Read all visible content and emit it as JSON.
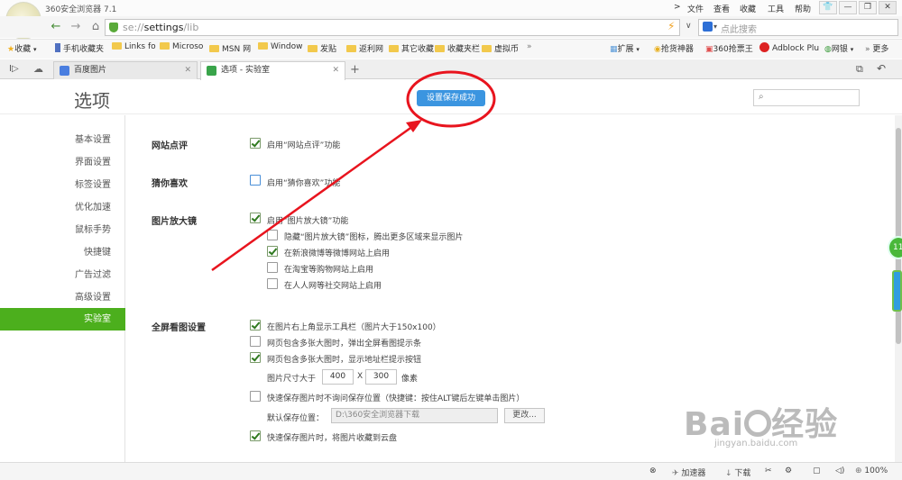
{
  "window": {
    "title": "360安全浏览器 7.1",
    "menu": [
      "文件",
      "查看",
      "收藏",
      "工具",
      "帮助"
    ]
  },
  "address": {
    "url_scheme": "se://",
    "url_path": "settings",
    "url_suffix": "/lib",
    "search_placeholder": "点此搜索"
  },
  "bookmarks": {
    "left": [
      "收藏",
      "手机收藏夹",
      "Links fo",
      "Microso",
      "MSN 网",
      "Window",
      "发贴",
      "返利网",
      "其它收藏",
      "收藏夹栏",
      "虚拟币"
    ],
    "right": [
      "扩展",
      "抢货神器",
      "360抢票王",
      "Adblock Plu",
      "网银",
      "更多"
    ]
  },
  "tabs": [
    {
      "label": "百度图片"
    },
    {
      "label": "选项 - 实验室"
    }
  ],
  "page": {
    "title": "选项",
    "toast": "设置保存成功"
  },
  "sidebar": {
    "items": [
      "基本设置",
      "界面设置",
      "标签设置",
      "优化加速",
      "鼠标手势",
      "快捷键",
      "广告过滤",
      "高级设置",
      "实验室"
    ],
    "active": "实验室"
  },
  "sections": {
    "review": {
      "title": "网站点评",
      "option": "启用“网站点评”功能",
      "checked": true
    },
    "guess": {
      "title": "猜你喜欢",
      "option": "启用“猜你喜欢”功能",
      "checked": false
    },
    "magnifier": {
      "title": "图片放大镜",
      "option": "启用“图片放大镜”功能",
      "checked": true,
      "sub": [
        {
          "label": "隐藏“图片放大镜”图标，腾出更多区域来显示图片",
          "checked": false
        },
        {
          "label": "在新浪微博等微博网站上启用",
          "checked": true
        },
        {
          "label": "在淘宝等购物网站上启用",
          "checked": false
        },
        {
          "label": "在人人网等社交网站上启用",
          "checked": false
        }
      ]
    },
    "fullscreen": {
      "title": "全屏看图设置",
      "options": [
        {
          "label": "在图片右上角显示工具栏（图片大于150x100）",
          "checked": true
        },
        {
          "label": "网页包含多张大图时，弹出全屏看图提示条",
          "checked": false
        },
        {
          "label": "网页包含多张大图时，显示地址栏提示按钮",
          "checked": true
        }
      ],
      "size_label": "图片尺寸大于",
      "width": "400",
      "x_sep": "X",
      "height": "300",
      "unit": "像素",
      "quick_save": {
        "label": "快速保存图片时不询问保存位置（快捷键：按住ALT键后左键单击图片）",
        "checked": false
      },
      "default_path_label": "默认保存位置：",
      "default_path": "D:\\360安全浏览器下载",
      "change_button": "更改...",
      "cloud": {
        "label": "快速保存图片时，将图片收藏到云盘",
        "checked": true
      }
    }
  },
  "statusbar": {
    "accelerator": "加速器",
    "download": "下载",
    "zoom": "100%"
  },
  "watermark": {
    "brand": "Baidu经验",
    "url": "jingyan.baidu.com"
  },
  "colors": {
    "accent_green": "#4caf1d",
    "toast_blue": "#3b95e0",
    "annotation_red": "#e8141e"
  }
}
